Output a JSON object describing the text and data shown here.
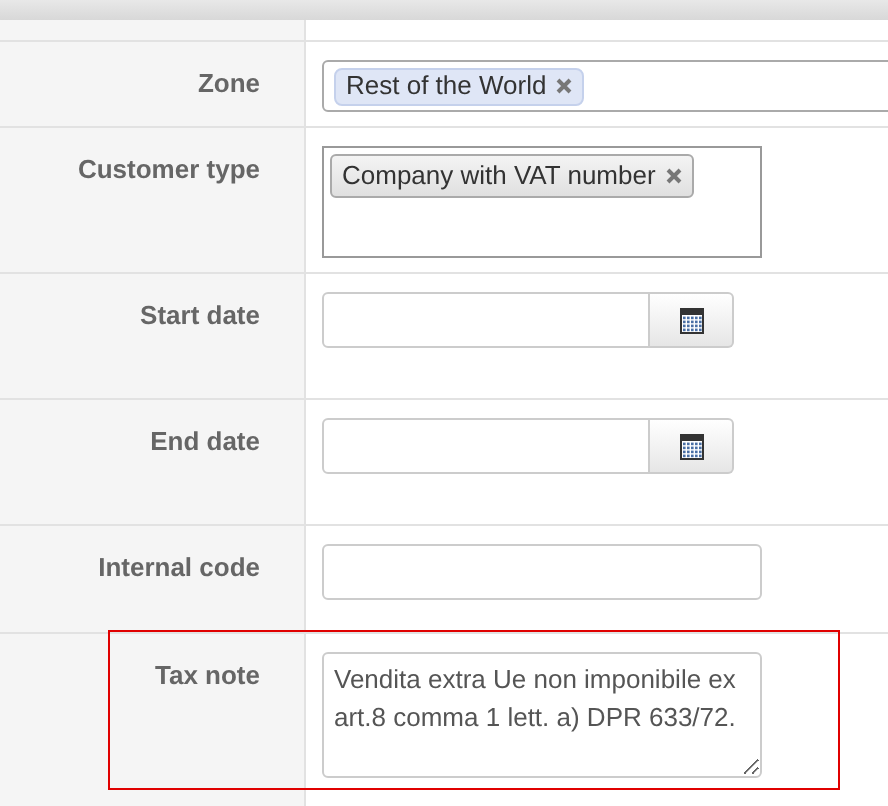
{
  "fields": [
    {
      "kind": "tags",
      "label": "Zone",
      "tags": [
        "Rest of the World"
      ],
      "highlighted": false
    },
    {
      "kind": "tagbox",
      "label": "Customer type",
      "tags": [
        "Company with VAT number"
      ],
      "highlighted": false
    },
    {
      "kind": "date",
      "label": "Start date",
      "highlighted": false
    },
    {
      "kind": "date",
      "label": "End date",
      "highlighted": false
    },
    {
      "kind": "text",
      "label": "Internal code",
      "highlighted": false
    },
    {
      "kind": "textarea",
      "label": "Tax note",
      "value": "Vendita extra Ue non imponibile ex art.8 comma 1 lett. a) DPR 633/72.",
      "highlighted": true
    }
  ]
}
